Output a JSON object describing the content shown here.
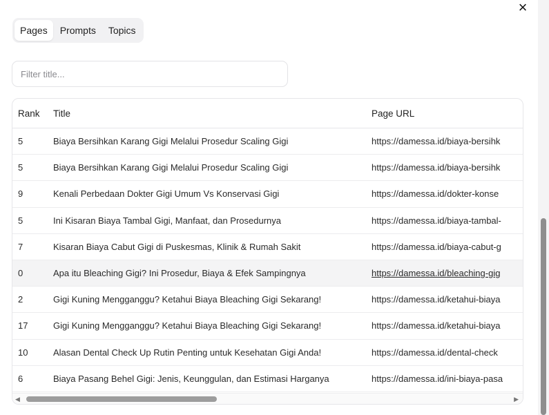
{
  "close_label": "×",
  "tabs": [
    {
      "label": "Pages",
      "active": true
    },
    {
      "label": "Prompts",
      "active": false
    },
    {
      "label": "Topics",
      "active": false
    }
  ],
  "filter": {
    "placeholder": "Filter title...",
    "value": ""
  },
  "table": {
    "headers": {
      "rank": "Rank",
      "title": "Title",
      "url": "Page URL"
    },
    "rows": [
      {
        "rank": "5",
        "title": "Biaya Bersihkan Karang Gigi Melalui Prosedur Scaling Gigi",
        "url": "https://damessa.id/biaya-bersihk"
      },
      {
        "rank": "5",
        "title": "Biaya Bersihkan Karang Gigi Melalui Prosedur Scaling Gigi",
        "url": "https://damessa.id/biaya-bersihk"
      },
      {
        "rank": "9",
        "title": "Kenali Perbedaan Dokter Gigi Umum Vs Konservasi Gigi",
        "url": "https://damessa.id/dokter-konse"
      },
      {
        "rank": "5",
        "title": "Ini Kisaran Biaya Tambal Gigi, Manfaat, dan Prosedurnya",
        "url": "https://damessa.id/biaya-tambal-"
      },
      {
        "rank": "7",
        "title": "Kisaran Biaya Cabut Gigi di Puskesmas, Klinik & Rumah Sakit",
        "url": "https://damessa.id/biaya-cabut-g"
      },
      {
        "rank": "0",
        "title": "Apa itu Bleaching Gigi? Ini Prosedur, Biaya & Efek Sampingnya",
        "url": "https://damessa.id/bleaching-gig"
      },
      {
        "rank": "2",
        "title": "Gigi Kuning Mengganggu? Ketahui Biaya Bleaching Gigi Sekarang!",
        "url": "https://damessa.id/ketahui-biaya"
      },
      {
        "rank": "17",
        "title": "Gigi Kuning Mengganggu? Ketahui Biaya Bleaching Gigi Sekarang!",
        "url": "https://damessa.id/ketahui-biaya"
      },
      {
        "rank": "10",
        "title": "Alasan Dental Check Up Rutin Penting untuk Kesehatan Gigi Anda!",
        "url": "https://damessa.id/dental-check"
      },
      {
        "rank": "6",
        "title": "Biaya Pasang Behel Gigi: Jenis, Keunggulan, dan Estimasi Harganya",
        "url": "https://damessa.id/ini-biaya-pasa"
      }
    ]
  },
  "scroll": {
    "left_arrow": "◀",
    "right_arrow": "▶"
  },
  "colors": {
    "hover_row": "#f4f4f5",
    "tab_group_bg": "#f1f1f3",
    "border": "#e6e6e9"
  }
}
